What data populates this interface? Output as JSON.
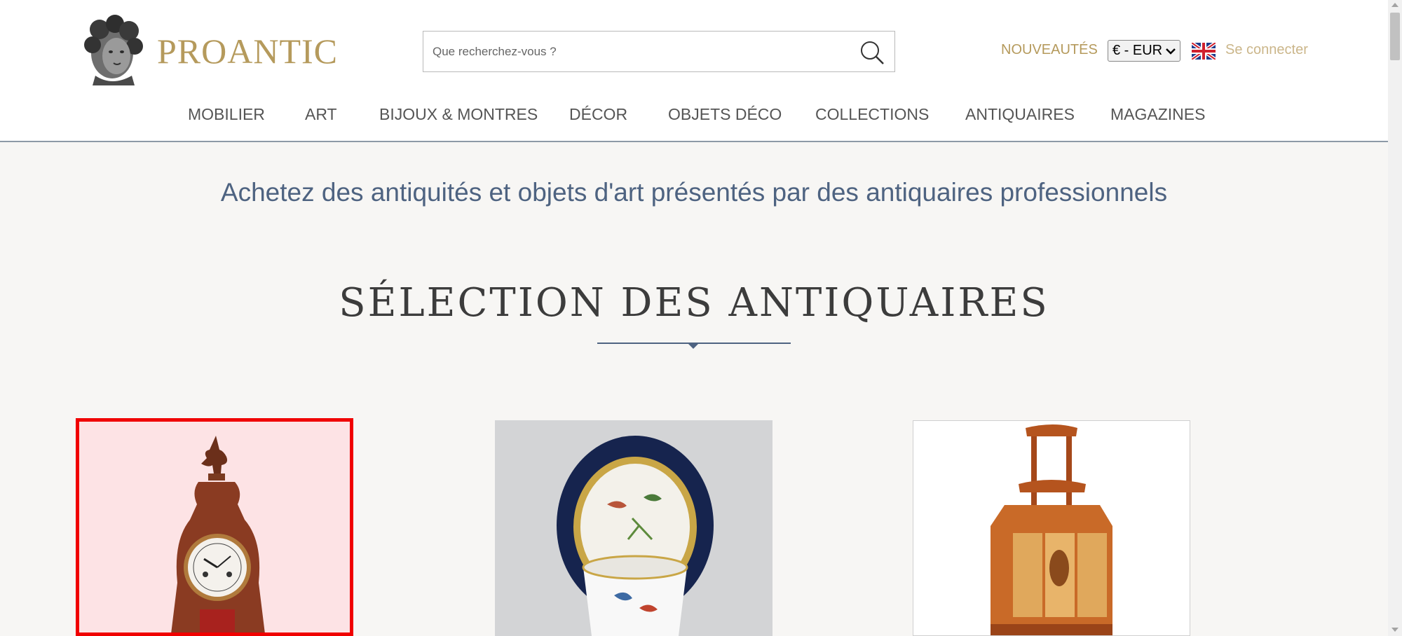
{
  "header": {
    "brand": "PROANTIC",
    "search": {
      "placeholder": "Que recherchez-vous ?",
      "value": ""
    },
    "news_label": "NOUVEAUTÉS",
    "currency": {
      "selected": "€ - EUR"
    },
    "login_label": "Se connecter",
    "language_flag": "uk-flag-icon"
  },
  "nav": {
    "items": [
      {
        "label": "MOBILIER"
      },
      {
        "label": "ART"
      },
      {
        "label": "BIJOUX & MONTRES"
      },
      {
        "label": "DÉCOR"
      },
      {
        "label": "OBJETS DÉCO"
      },
      {
        "label": "COLLECTIONS"
      },
      {
        "label": "ANTIQUAIRES"
      },
      {
        "label": "MAGAZINES"
      }
    ]
  },
  "main": {
    "tagline": "Achetez des antiquités et objets d'art présentés par des antiquaires professionnels",
    "section_title": "SÉLECTION DES ANTIQUAIRES",
    "products": [
      {
        "image": "bracket-clock",
        "highlighted": true
      },
      {
        "image": "porcelain-cup-and-saucer",
        "highlighted": false
      },
      {
        "image": "corner-etagere-cabinet",
        "highlighted": false
      }
    ]
  },
  "colors": {
    "brand_gold": "#b59a5c",
    "nav_text": "#555555",
    "tagline_blue": "#4e6381",
    "highlight_red": "#f00000",
    "page_bg": "#f7f6f4"
  }
}
